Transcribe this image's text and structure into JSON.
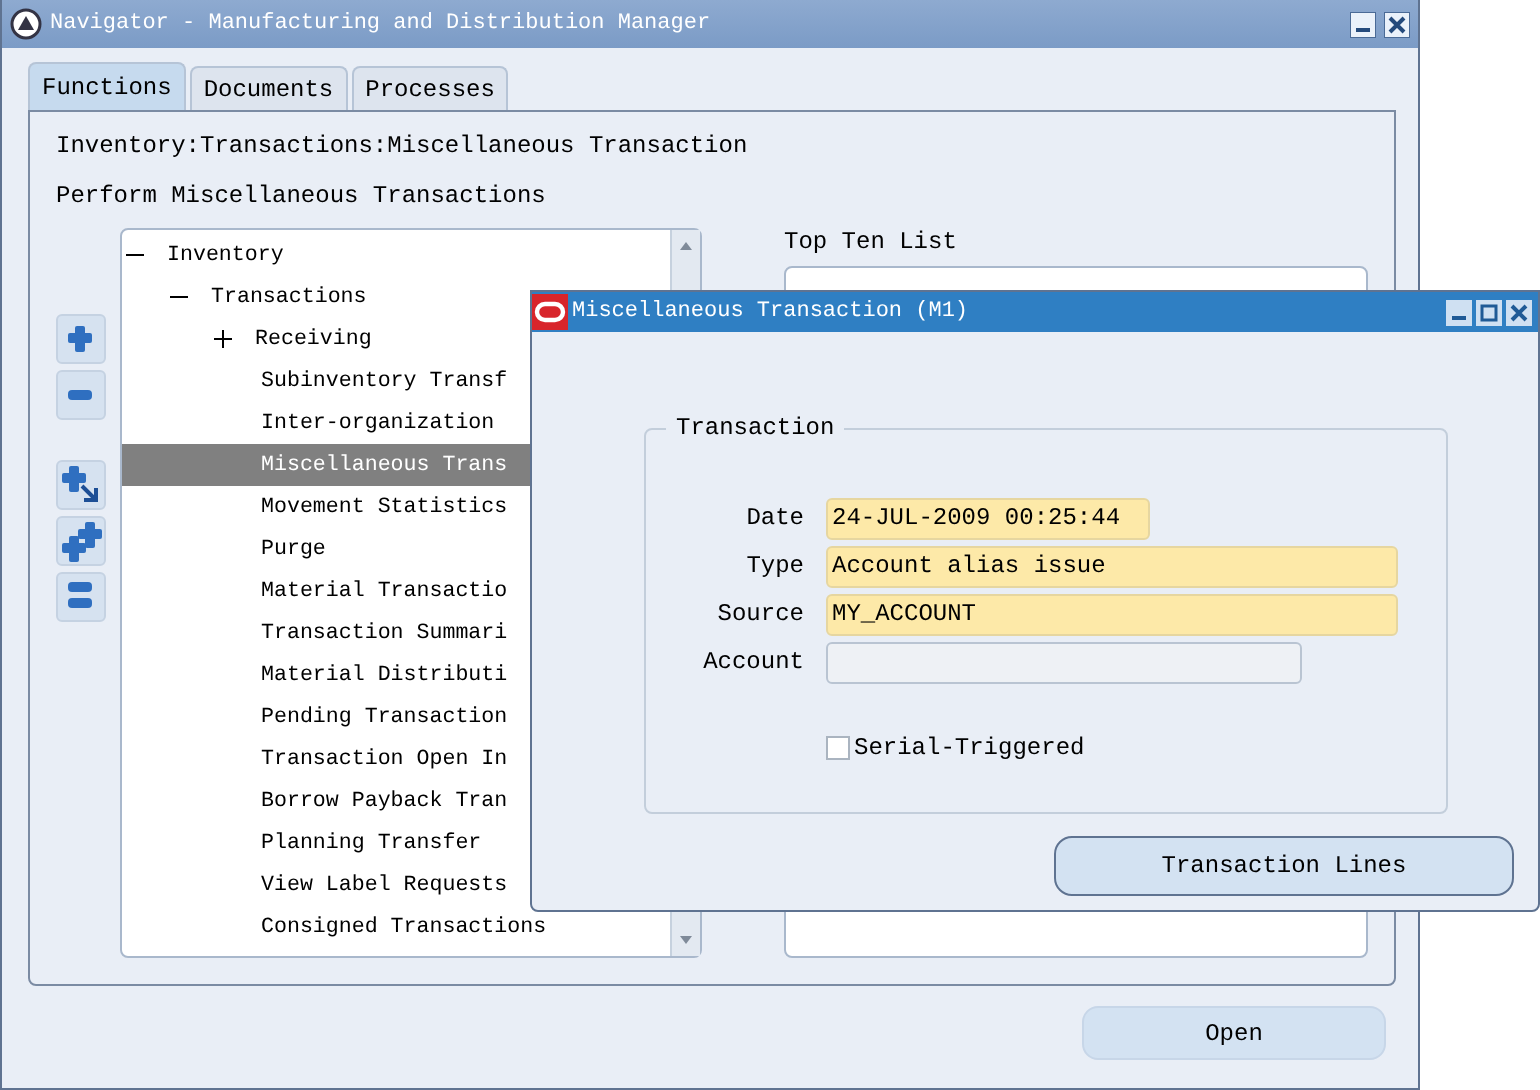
{
  "navigator": {
    "title": "Navigator - Manufacturing and Distribution Manager",
    "tabs": [
      {
        "label": "Functions",
        "selected": true
      },
      {
        "label": "Documents",
        "selected": false
      },
      {
        "label": "Processes",
        "selected": false
      }
    ],
    "path": "Inventory:Transactions:Miscellaneous Transaction",
    "description": "Perform Miscellaneous Transactions",
    "tree": [
      {
        "label": "Inventory",
        "expanded": true,
        "selected": false,
        "children": [
          {
            "label": "Transactions",
            "expanded": true,
            "selected": false,
            "children": [
              {
                "label": "Receiving",
                "expanded": false,
                "selected": false
              },
              {
                "label": "Subinventory Transf",
                "selected": false
              },
              {
                "label": "Inter-organization",
                "selected": false
              },
              {
                "label": "Miscellaneous Trans",
                "selected": true
              },
              {
                "label": "Movement Statistics",
                "selected": false
              },
              {
                "label": "Purge",
                "selected": false
              },
              {
                "label": "Material Transactio",
                "selected": false
              },
              {
                "label": "Transaction Summari",
                "selected": false
              },
              {
                "label": "Material Distributi",
                "selected": false
              },
              {
                "label": "Pending Transaction",
                "selected": false
              },
              {
                "label": "Transaction Open In",
                "selected": false
              },
              {
                "label": "Borrow Payback Tran",
                "selected": false
              },
              {
                "label": "Planning Transfer",
                "selected": false
              },
              {
                "label": "View Label Requests",
                "selected": false
              },
              {
                "label": "Consigned Transactions",
                "selected": false
              }
            ]
          }
        ]
      }
    ],
    "top_ten_label": "Top Ten List",
    "open_button": "Open"
  },
  "dialog": {
    "title": "Miscellaneous Transaction (M1)",
    "group": "Transaction",
    "fields": [
      {
        "label": "Date",
        "value": "24-JUL-2009 00:25:44",
        "required": true
      },
      {
        "label": "Type",
        "value": "Account alias issue",
        "required": true
      },
      {
        "label": "Source",
        "value": "MY_ACCOUNT",
        "required": true
      },
      {
        "label": "Account",
        "required": false
      }
    ],
    "checkbox": {
      "label": "Serial-Triggered",
      "checked": false
    },
    "button": "Transaction Lines"
  }
}
